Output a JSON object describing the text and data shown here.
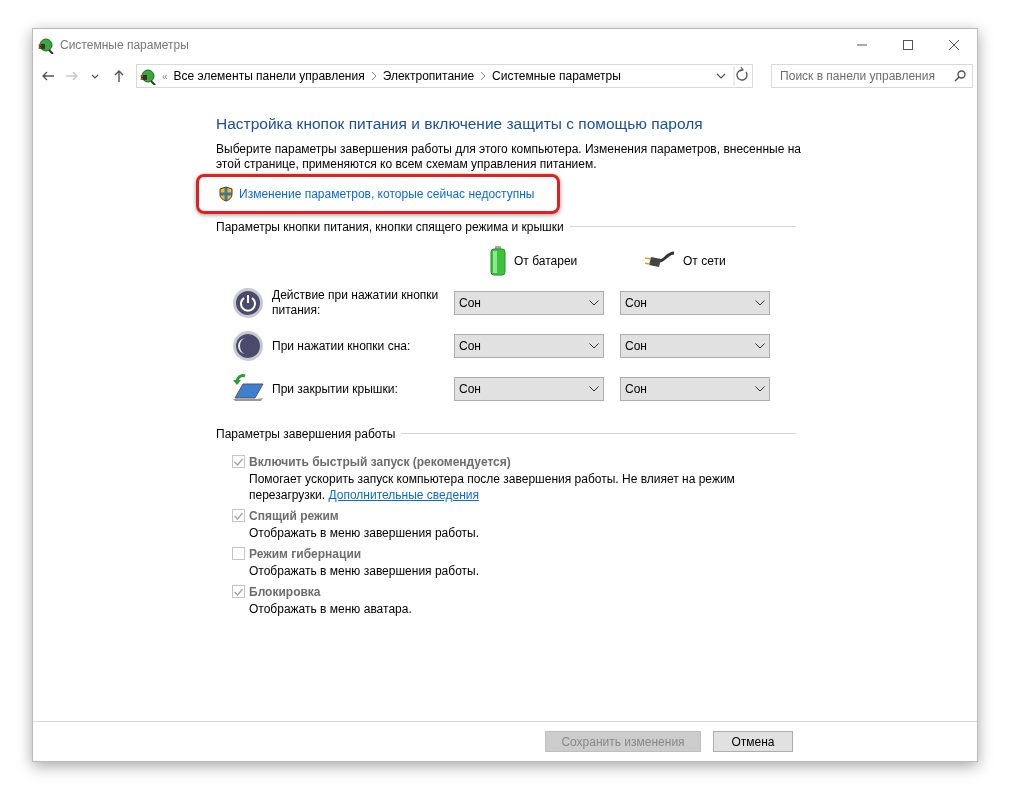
{
  "window": {
    "title": "Системные параметры"
  },
  "nav_buttons": [
    {
      "kind": "back",
      "disabled": false
    },
    {
      "kind": "forward",
      "disabled": true
    },
    {
      "kind": "recent",
      "disabled": false
    },
    {
      "kind": "up",
      "disabled": false
    }
  ],
  "address": {
    "overflow": "«",
    "breadcrumbs": [
      "Все элементы панели управления",
      "Электропитание",
      "Системные параметры"
    ]
  },
  "search": {
    "placeholder": "Поиск в панели управления"
  },
  "heading": "Настройка кнопок питания и включение защиты с помощью пароля",
  "description": "Выберите параметры завершения работы для этого компьютера. Изменения параметров, внесенные на этой странице, применяются ко всем схемам управления питанием.",
  "admin_link": {
    "label": "Изменение параметров, которые сейчас недоступны",
    "highlighted": true
  },
  "buttons_section": {
    "title": "Параметры кнопки питания, кнопки спящего режима и крышки",
    "columns": [
      {
        "kind": "battery",
        "label": "От батареи"
      },
      {
        "kind": "plug",
        "label": "От сети"
      }
    ],
    "rows": [
      {
        "kind": "power",
        "label": "Действие при нажатии кнопки питания:",
        "values": [
          "Сон",
          "Сон"
        ]
      },
      {
        "kind": "sleep",
        "label": "При нажатии кнопки сна:",
        "values": [
          "Сон",
          "Сон"
        ]
      },
      {
        "kind": "lid",
        "label": "При закрытии крышки:",
        "values": [
          "Сон",
          "Сон"
        ]
      }
    ]
  },
  "shutdown_section": {
    "title": "Параметры завершения работы",
    "options": [
      {
        "label": "Включить быстрый запуск (рекомендуется)",
        "checked": true,
        "disabled": true,
        "description": "Помогает ускорить запуск компьютера после завершения работы. Не влияет на режим перезагрузки.",
        "link": "Дополнительные сведения"
      },
      {
        "label": "Спящий режим",
        "checked": true,
        "disabled": true,
        "description": "Отображать в меню завершения работы."
      },
      {
        "label": "Режим гибернации",
        "checked": false,
        "disabled": true,
        "description": "Отображать в меню завершения работы."
      },
      {
        "label": "Блокировка",
        "checked": true,
        "disabled": true,
        "description": "Отображать в меню аватара."
      }
    ]
  },
  "footer_buttons": [
    {
      "label": "Сохранить изменения",
      "disabled": true
    },
    {
      "label": "Отмена",
      "disabled": false
    }
  ]
}
